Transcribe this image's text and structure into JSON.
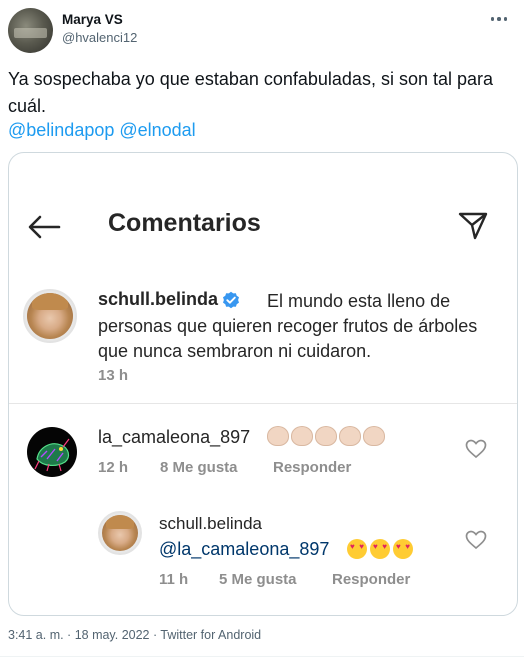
{
  "tweet": {
    "display_name": "Marya VS",
    "handle": "@hvalenci12",
    "text": "Ya sospechaba yo que estaban confabuladas, si son tal para cuál.",
    "mentions": [
      "@belindapop",
      "@elnodal"
    ],
    "meta": "3:41 a. m. · 18 may. 2022 · Twitter for Android"
  },
  "embedded": {
    "title": "Comentarios",
    "main_comment": {
      "user": "schull.belinda",
      "text": "El mundo esta lleno de personas que quieren recoger frutos de árboles que nunca sembraron ni cuidaron.",
      "time": "13 h"
    },
    "comments": [
      {
        "user": "la_camaleona_897",
        "time": "12 h",
        "likes": "8 Me gusta",
        "reply_label": "Responder"
      },
      {
        "user": "schull.belinda",
        "mention": "@la_camaleona_897",
        "time": "11 h",
        "likes": "5 Me gusta",
        "reply_label": "Responder"
      }
    ]
  },
  "colors": {
    "twitter_blue": "#1d9bf0",
    "ig_verified": "#3897f0",
    "ig_mention": "#00376b",
    "muted": "#8e8e8e"
  },
  "icons": [
    "more-icon",
    "back-arrow-icon",
    "send-icon",
    "verified-icon",
    "heart-icon"
  ]
}
